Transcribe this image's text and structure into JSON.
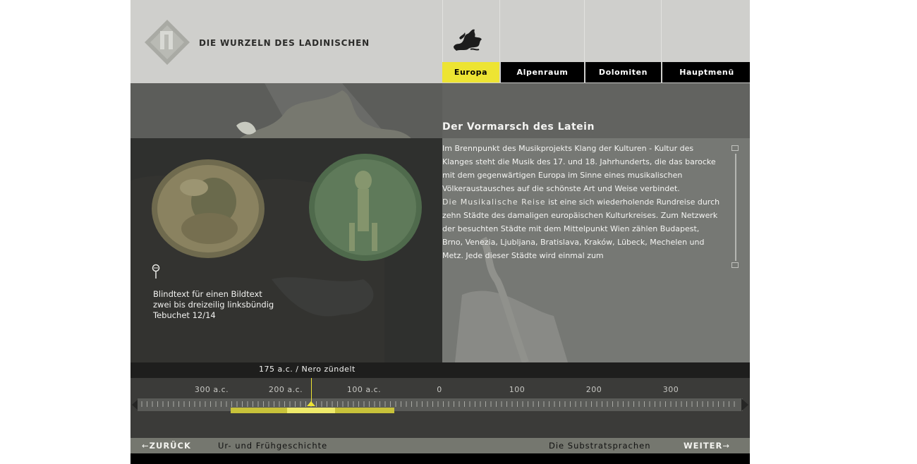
{
  "header": {
    "brand_title": "DIE WURZELN DES LADINISCHEN"
  },
  "nav": {
    "tabs": [
      {
        "label": "Europa",
        "active": true
      },
      {
        "label": "Alpenraum",
        "active": false
      },
      {
        "label": "Dolomiten",
        "active": false
      },
      {
        "label": "Hauptmenü",
        "active": false
      }
    ]
  },
  "article": {
    "title": "Der Vormarsch des Latein",
    "para1": "Im Brennpunkt des Musikprojekts Klang der Kulturen - Kultur des Klanges steht die Musik des 17. und 18. Jahrhunderts, die das barocke mit dem gegenwärtigen Europa im Sinne eines musikalischen Völkeraustausches auf die schönste Art und Weise verbindet.",
    "para2_highlight": "Die Musikalische Reise",
    "para2_rest": " ist eine sich wiederholende Rundreise durch zehn Städte des damaligen europäischen Kulturkreises. Zum Netzwerk der besuchten Städte mit dem Mittelpunkt Wien zählen Budapest, Brno, Venezia, Ljubljana, Bratislava, Kraków, Lübeck, Mechelen und Metz. Jede dieser Städte wird einmal zum"
  },
  "caption": {
    "line1": "Blindtext für einen Bildtext",
    "line2": "zwei bis dreizeilig linksbündig",
    "line3": "Tebuchet 12/14"
  },
  "timeline": {
    "current_label": "175 a.c. / Nero zündelt",
    "years": [
      "300 a.c.",
      "200 a.c.",
      "100 a.c.",
      "0",
      "100",
      "200",
      "300"
    ],
    "colors": {
      "accent": "#ede433",
      "range": "#c8c23a"
    }
  },
  "footer": {
    "back_label": "ZURÜCK",
    "prev_section": "Ur- und Frühgeschichte",
    "next_section": "Die Substratsprachen",
    "next_label": "WEITER"
  }
}
